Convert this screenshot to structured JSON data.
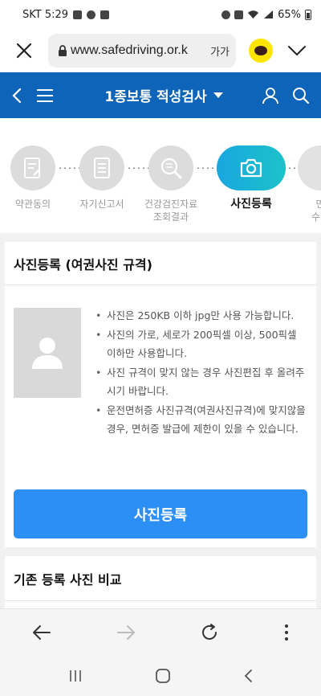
{
  "status_bar": {
    "carrier_time": "SKT 5:29",
    "battery": "65%"
  },
  "browser": {
    "url": "www.safedriving.or.k",
    "text_size_label": "가가"
  },
  "app_bar": {
    "title": "1종보통 적성검사"
  },
  "steps": [
    {
      "label": "약관동의"
    },
    {
      "label": "자기신고서"
    },
    {
      "label_line1": "건강검진자료",
      "label_line2": "조회결과"
    },
    {
      "label": "사진등록"
    },
    {
      "label_line1": "면",
      "label_line2": "수령"
    }
  ],
  "photo_section": {
    "title": "사진등록 (여권사진 규격)",
    "notes": [
      "사진은 250KB 이하 jpg만 사용 가능합니다.",
      "사진의 가로, 세로가 200픽셀 이상, 500픽셀 이하만 사용합니다.",
      "사진 규격이 맞지 않는 경우 사진편집 후 올려주시기 바랍니다.",
      "운전면허증 사진규격(여권사진규격)에 맞지않을 경우, 면허증 발급에 제한이 있을 수 있습니다."
    ],
    "button_label": "사진등록"
  },
  "compare_section": {
    "title": "기존 등록 사진 비교"
  },
  "colors": {
    "app_bar": "#0d64b8",
    "primary_button": "#2b8ff5",
    "active_step_start": "#19a7df",
    "active_step_end": "#1cc2c9"
  }
}
